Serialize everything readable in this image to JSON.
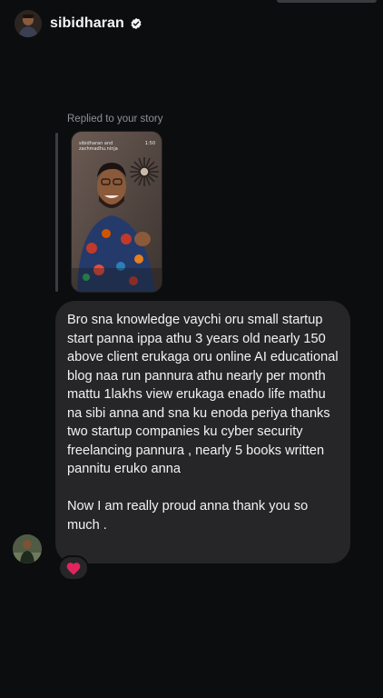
{
  "header": {
    "username": "sibidharan",
    "verified": true
  },
  "reply": {
    "label": "Replied to your story",
    "story_caption": "sibidharan and zachmadhu.ninja",
    "story_time": "1:50"
  },
  "message": {
    "text": "Bro sna knowledge vaychi oru small startup start panna ippa athu 3 years old nearly 150 above client erukaga oru online AI educational blog naa run pannura athu nearly per month mattu 1lakhs view erukaga enado life mathu na sibi anna and sna ku enoda periya thanks two startup companies ku cyber security freelancing pannura , nearly 5 books written pannitu eruko anna\n\nNow I am really proud anna thank you so much ."
  },
  "reaction": {
    "emoji_icon": "red-heart-icon",
    "color": "#e0245e"
  },
  "colors": {
    "background": "#0c0d0f",
    "bubble": "#262629",
    "muted_text": "#8e9096"
  }
}
